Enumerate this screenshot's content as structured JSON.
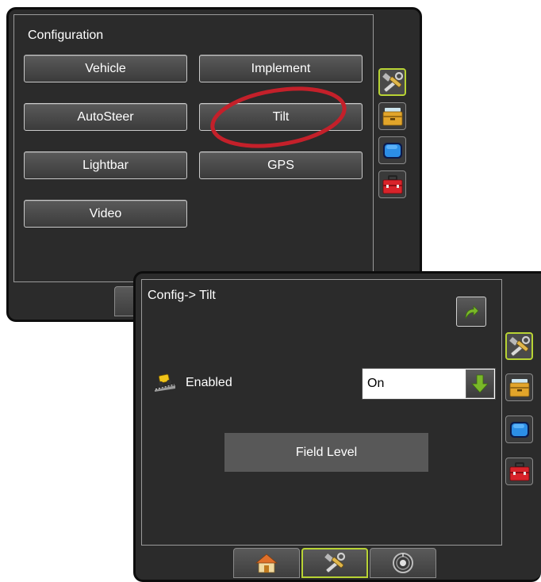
{
  "configuration_screen": {
    "title": "Configuration",
    "buttons": [
      "Vehicle",
      "Implement",
      "AutoSteer",
      "Tilt",
      "Lightbar",
      "GPS",
      "Video"
    ],
    "side_tabs": [
      "tools-icon",
      "console-icon",
      "display-icon",
      "toolbox-icon"
    ],
    "highlighted_button": "Tilt",
    "highlight_color": "#c4202a"
  },
  "tilt_screen": {
    "title": "Config-> Tilt",
    "enabled_label": "Enabled",
    "enabled_value": "On",
    "field_level_label": "Field Level",
    "side_tabs": [
      "tools-icon",
      "console-icon",
      "display-icon",
      "toolbox-icon"
    ],
    "bottom_tabs": [
      "home-icon",
      "tools-icon",
      "guidance-icon"
    ],
    "active_tab": "tools-icon"
  },
  "colors": {
    "accent_active": "#b8d334",
    "arrow_green": "#7ab829",
    "screen_bg": "#2b2b2b"
  }
}
